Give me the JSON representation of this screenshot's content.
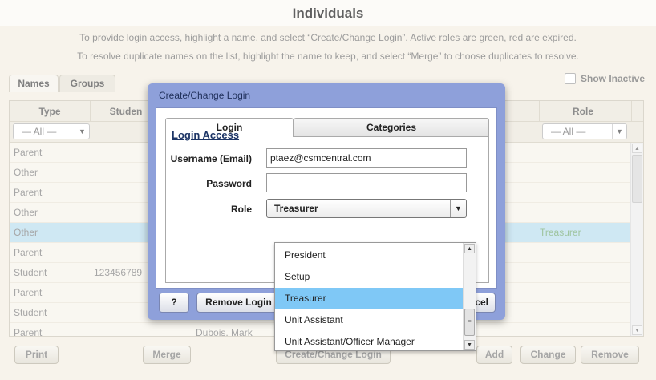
{
  "page": {
    "title": "Individuals",
    "instructions": [
      "To provide login access, highlight a name, and select “Create/Change Login”. Active roles are green, red are expired.",
      "To resolve duplicate names on the list, highlight the name to keep, and select “Merge” to choose duplicates to resolve."
    ],
    "tabs": [
      "Names",
      "Groups"
    ],
    "show_inactive_label": "Show Inactive"
  },
  "grid": {
    "columns": {
      "type": "Type",
      "student": "Studen",
      "role": "Role"
    },
    "filter_all": "— All —",
    "rows": [
      {
        "type": "Parent",
        "student": "",
        "name": "",
        "role": ""
      },
      {
        "type": "Other",
        "student": "",
        "name": "",
        "role": ""
      },
      {
        "type": "Parent",
        "student": "",
        "name": "",
        "role": ""
      },
      {
        "type": "Other",
        "student": "",
        "name": "",
        "role": ""
      },
      {
        "type": "Other",
        "student": "",
        "name": "",
        "role": "Treasurer",
        "selected": true
      },
      {
        "type": "Parent",
        "student": "",
        "name": "",
        "role": ""
      },
      {
        "type": "Student",
        "student": "123456789",
        "name": "",
        "role": ""
      },
      {
        "type": "Parent",
        "student": "",
        "name": "",
        "role": ""
      },
      {
        "type": "Student",
        "student": "",
        "name": "",
        "role": ""
      },
      {
        "type": "Parent",
        "student": "",
        "name": "Dubois, Mark",
        "role": ""
      }
    ]
  },
  "bottom_buttons": {
    "print": "Print",
    "merge": "Merge",
    "create_change_login": "Create/Change Login",
    "add": "Add",
    "change": "Change",
    "remove": "Remove"
  },
  "dialog": {
    "title": "Create/Change Login",
    "tabs": {
      "login": "Login",
      "categories": "Categories"
    },
    "section_title": "Login Access",
    "username_label": "Username (Email)",
    "username_value": "ptaez@csmcentral.com",
    "password_label": "Password",
    "password_value": "",
    "role_label": "Role",
    "role_value": "Treasurer",
    "buttons": {
      "help": "?",
      "remove_login": "Remove Login",
      "cancel_fragment": "cel"
    }
  },
  "role_options": [
    "President",
    "Setup",
    "Treasurer",
    "Unit Assistant",
    "Unit Assistant/Officer Manager"
  ],
  "role_selected_index": 2,
  "colors": {
    "dialog_frame": "#8ea0da",
    "selected_row": "#bfe0ef",
    "selected_option": "#7fc8f6",
    "active_role": "#58a058"
  }
}
